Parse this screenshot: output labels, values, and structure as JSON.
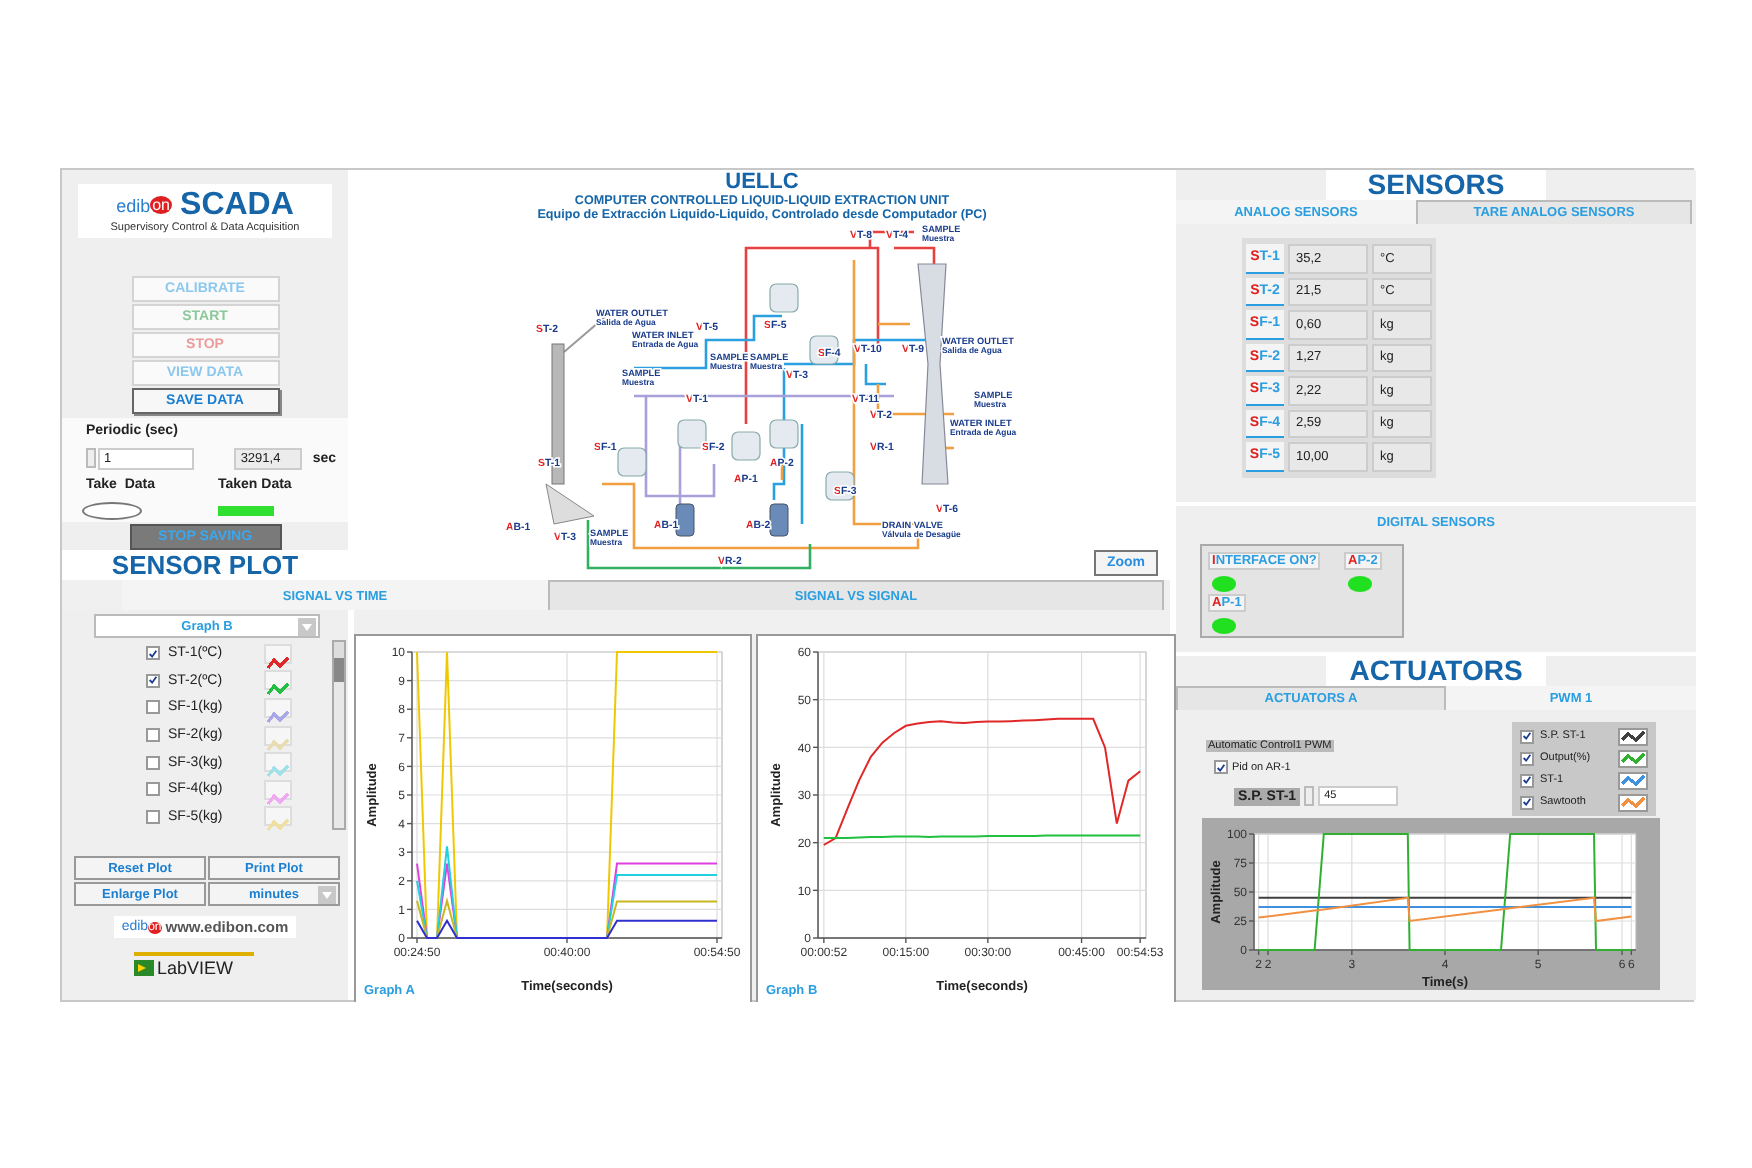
{
  "logo": {
    "brand": "edibon",
    "title": "SCADA",
    "subtitle": "Supervisory Control & Data Acquisition"
  },
  "control_buttons": [
    {
      "label": "CALIBRATE",
      "disabled": true,
      "color": "#8cc8ee"
    },
    {
      "label": "START",
      "disabled": true,
      "color": "#8cc89a"
    },
    {
      "label": "STOP",
      "disabled": true,
      "color": "#ee9a9a"
    },
    {
      "label": "VIEW DATA",
      "disabled": true,
      "color": "#8cc8ee"
    },
    {
      "label": "SAVE DATA",
      "disabled": false,
      "color": "#1a7fd0"
    }
  ],
  "acquisition": {
    "periodic_label": "Periodic (sec)",
    "period": "1",
    "elapsed": "3291,4",
    "elapsed_unit": "sec",
    "take_data_label": "Take  Data",
    "take_data": false,
    "taken_data_label": "Taken Data",
    "taken_data": true,
    "stop_button": "STOP SAVING"
  },
  "diagram": {
    "title": "UELLC",
    "subtitle": "COMPUTER CONTROLLED LIQUID-LIQUID EXTRACTION UNIT",
    "subtitle_es": "Equipo de Extracción Liquido-Liquido, Controlado desde Computador (PC)",
    "zoom_button": "Zoom",
    "labels": [
      {
        "text": "VT-8"
      },
      {
        "text": "VT-4"
      },
      {
        "text": "SAMPLE",
        "sub": "Muestra"
      },
      {
        "text": "ST-2"
      },
      {
        "text": "WATER OUTLET",
        "sub": "Salida de Agua"
      },
      {
        "text": "WATER INLET",
        "sub": "Entrada de Agua"
      },
      {
        "text": "VT-5"
      },
      {
        "text": "SF-5"
      },
      {
        "text": "VT-10"
      },
      {
        "text": "VT-9"
      },
      {
        "text": "WATER OUTLET",
        "sub": "Salida de Agua"
      },
      {
        "text": "SAMPLE",
        "sub": "Muestra"
      },
      {
        "text": "SAMPLE",
        "sub": "Muestra"
      },
      {
        "text": "SF-4"
      },
      {
        "text": "SAMPLE",
        "sub": "Muestra"
      },
      {
        "text": "VT-3"
      },
      {
        "text": "VT-1"
      },
      {
        "text": "VT-11"
      },
      {
        "text": "SAMPLE",
        "sub": "Muestra"
      },
      {
        "text": "VT-2"
      },
      {
        "text": "WATER INLET",
        "sub": "Entrada de Agua"
      },
      {
        "text": "SF-1"
      },
      {
        "text": "SF-2"
      },
      {
        "text": "VR-1"
      },
      {
        "text": "ST-1"
      },
      {
        "text": "AP-2"
      },
      {
        "text": "AP-1"
      },
      {
        "text": "SF-3"
      },
      {
        "text": "VT-6"
      },
      {
        "text": "AB-1"
      },
      {
        "text": "VT-3"
      },
      {
        "text": "SAMPLE",
        "sub": "Muestra"
      },
      {
        "text": "AB-1"
      },
      {
        "text": "AB-2"
      },
      {
        "text": "DRAIN VALVE",
        "sub": "Válvula de Desagüe"
      },
      {
        "text": "VR-2"
      }
    ]
  },
  "sensor_plot": {
    "title": "SENSOR PLOT",
    "tabs": [
      {
        "label": "SIGNAL VS TIME",
        "selected": true
      },
      {
        "label": "SIGNAL VS SIGNAL",
        "selected": false
      }
    ],
    "graph_select": "Graph B",
    "channels": [
      {
        "name": "ST-1(ºC)",
        "checked": true,
        "color": "#e02828"
      },
      {
        "name": "ST-2(ºC)",
        "checked": true,
        "color": "#22c040"
      },
      {
        "name": "SF-1(kg)",
        "checked": false,
        "color": "#a8a8e8"
      },
      {
        "name": "SF-2(kg)",
        "checked": false,
        "color": "#e8dcb0"
      },
      {
        "name": "SF-3(kg)",
        "checked": false,
        "color": "#a0e0e8"
      },
      {
        "name": "SF-4(kg)",
        "checked": false,
        "color": "#f0a8f0"
      },
      {
        "name": "SF-5(kg)",
        "checked": false,
        "color": "#f0e0a0"
      }
    ],
    "buttons": [
      "Reset Plot",
      "Print Plot",
      "Enlarge Plot"
    ],
    "units_select": "minutes",
    "graphs": [
      {
        "label": "Graph A",
        "chart_data": {
          "type": "line",
          "xlabel": "Time(seconds)",
          "ylabel": "Amplitude",
          "grid": true,
          "categories": [
            "00:24:50",
            null,
            null,
            null,
            null,
            null,
            null,
            null,
            null,
            null,
            null,
            null,
            null,
            null,
            null,
            "00:40:00",
            null,
            null,
            null,
            null,
            null,
            null,
            null,
            null,
            null,
            null,
            null,
            null,
            null,
            null,
            "00:54:50"
          ],
          "ylim": [
            0,
            10
          ],
          "yticks": [
            0,
            {
              "value": 1,
              "label": "1"
            },
            2,
            3,
            4,
            5,
            6,
            7,
            8,
            9,
            10
          ],
          "series": [
            {
              "color": "#f0c800",
              "values": [
                10,
                0,
                0,
                10,
                0,
                0,
                0,
                0,
                0,
                0,
                0,
                0,
                0,
                0,
                0,
                0,
                0,
                0,
                0,
                0,
                10,
                10,
                10,
                10,
                10,
                10,
                10,
                10,
                10,
                10,
                10
              ]
            },
            {
              "color": "#e040e0",
              "values": [
                2.6,
                0,
                0,
                2.6,
                0,
                0,
                0,
                0,
                0,
                0,
                0,
                0,
                0,
                0,
                0,
                0,
                0,
                0,
                0,
                0,
                2.6,
                2.6,
                2.6,
                2.6,
                2.6,
                2.6,
                2.6,
                2.6,
                2.6,
                2.6,
                2.6
              ]
            },
            {
              "color": "#20d0e0",
              "values": [
                2,
                0,
                0,
                3.2,
                0,
                0,
                0,
                0,
                0,
                0,
                0,
                0,
                0,
                0,
                0,
                0,
                0,
                0,
                0,
                0,
                2.2,
                2.2,
                2.2,
                2.2,
                2.2,
                2.2,
                2.2,
                2.2,
                2.2,
                2.2,
                2.2
              ]
            },
            {
              "color": "#c8b820",
              "values": [
                1.3,
                0,
                0,
                1.3,
                0,
                0,
                0,
                0,
                0,
                0,
                0,
                0,
                0,
                0,
                0,
                0,
                0,
                0,
                0,
                0,
                1.27,
                1.27,
                1.27,
                1.27,
                1.27,
                1.27,
                1.27,
                1.27,
                1.27,
                1.27,
                1.27
              ]
            },
            {
              "color": "#3030d0",
              "values": [
                0.6,
                0,
                0,
                0.6,
                0,
                0,
                0,
                0,
                0,
                0,
                0,
                0,
                0,
                0,
                0,
                0,
                0,
                0,
                0,
                0,
                0.6,
                0.6,
                0.6,
                0.6,
                0.6,
                0.6,
                0.6,
                0.6,
                0.6,
                0.6,
                0.6
              ]
            }
          ]
        }
      },
      {
        "label": "Graph B",
        "chart_data": {
          "type": "line",
          "xlabel": "Time(seconds)",
          "ylabel": "Amplitude",
          "grid": true,
          "categories": [
            "00:00:52",
            null,
            null,
            null,
            null,
            null,
            null,
            "00:15:00",
            null,
            null,
            null,
            null,
            null,
            null,
            "00:30:00",
            null,
            null,
            null,
            null,
            null,
            null,
            null,
            "00:45:00",
            null,
            null,
            null,
            null,
            "00:54:53"
          ],
          "ylim": [
            0,
            60
          ],
          "yticks": [
            0,
            10,
            20,
            30,
            40,
            50,
            60
          ],
          "series": [
            {
              "color": "#e02828",
              "values": [
                19.5,
                21,
                27,
                33,
                38,
                41,
                43,
                44.5,
                45,
                45.3,
                45.5,
                45.2,
                45.1,
                45.3,
                45.4,
                45.4,
                45.5,
                45.6,
                45.7,
                45.8,
                46,
                46,
                46,
                46,
                40,
                24,
                33,
                35
              ]
            },
            {
              "color": "#22c040",
              "values": [
                21,
                21,
                21,
                21.1,
                21.2,
                21.2,
                21.3,
                21.3,
                21.3,
                21.2,
                21.3,
                21.3,
                21.3,
                21.3,
                21.4,
                21.4,
                21.4,
                21.4,
                21.4,
                21.5,
                21.5,
                21.5,
                21.5,
                21.5,
                21.5,
                21.5,
                21.5,
                21.5
              ]
            }
          ]
        }
      }
    ]
  },
  "footer": {
    "brand": "edibon",
    "website": "www.edibon.com",
    "labview": "LabVIEW"
  },
  "sensors": {
    "title": "SENSORS",
    "tabs": [
      {
        "label": "ANALOG SENSORS",
        "selected": true
      },
      {
        "label": "TARE ANALOG SENSORS",
        "selected": false
      }
    ],
    "readings": [
      {
        "name": "ST-1",
        "value": "35,2",
        "unit": "°C"
      },
      {
        "name": "ST-2",
        "value": "21,5",
        "unit": "°C"
      },
      {
        "name": "SF-1",
        "value": "0,60",
        "unit": "kg"
      },
      {
        "name": "SF-2",
        "value": "1,27",
        "unit": "kg"
      },
      {
        "name": "SF-3",
        "value": "2,22",
        "unit": "kg"
      },
      {
        "name": "SF-4",
        "value": "2,59",
        "unit": "kg"
      },
      {
        "name": "SF-5",
        "value": "10,00",
        "unit": "kg"
      }
    ],
    "digital_title": "DIGITAL SENSORS",
    "digital": [
      {
        "name": "INTERFACE ON?",
        "on": true
      },
      {
        "name": "AP-2",
        "on": true
      },
      {
        "name": "AP-1",
        "on": true
      }
    ]
  },
  "actuators": {
    "title": "ACTUATORS",
    "tabs": [
      {
        "label": "ACTUATORS A",
        "selected": false
      },
      {
        "label": "PWM 1",
        "selected": true
      }
    ],
    "mode_label": "Automatic Control1 PWM",
    "pid": {
      "label": "Pid on AR-1",
      "checked": true
    },
    "setpoint_label": "S.P. ST-1",
    "setpoint": "45",
    "legend": [
      {
        "name": "S.P. ST-1",
        "checked": true,
        "color": "#404040"
      },
      {
        "name": "Output(%)",
        "checked": true,
        "color": "#30b030"
      },
      {
        "name": "ST-1",
        "checked": true,
        "color": "#4090e0"
      },
      {
        "name": "Sawtooth",
        "checked": true,
        "color": "#f09040"
      }
    ],
    "chart_data": {
      "type": "line",
      "xlabel": "Time(s)",
      "ylabel": "Amplitude",
      "grid": true,
      "x": [
        2,
        2.6,
        2.7,
        3.6,
        3.62,
        4.6,
        4.7,
        5.6,
        5.62,
        6
      ],
      "xlim": [
        1.95,
        6.05
      ],
      "ylim": [
        0,
        100
      ],
      "xticks": [
        {
          "value": 2,
          "label": "2"
        },
        {
          "value": 2.1,
          "label": "2"
        },
        3,
        4,
        5,
        {
          "value": 5.9,
          "label": "6"
        },
        {
          "value": 6,
          "label": "6"
        }
      ],
      "yticks": [
        0,
        25,
        50,
        75,
        100
      ],
      "series": [
        {
          "color": "#404040",
          "values": [
            45,
            45,
            45,
            45,
            45,
            45,
            45,
            45,
            45,
            45
          ]
        },
        {
          "color": "#30b030",
          "values": [
            0,
            0,
            100,
            100,
            0,
            0,
            100,
            100,
            0,
            0
          ]
        },
        {
          "color": "#4090e0",
          "values": [
            37,
            37,
            37,
            37,
            37,
            37,
            37,
            37,
            37,
            37
          ]
        },
        {
          "color": "#f09040",
          "values": [
            28,
            34,
            35,
            45,
            25,
            35,
            36,
            45,
            25,
            29
          ]
        }
      ]
    }
  }
}
